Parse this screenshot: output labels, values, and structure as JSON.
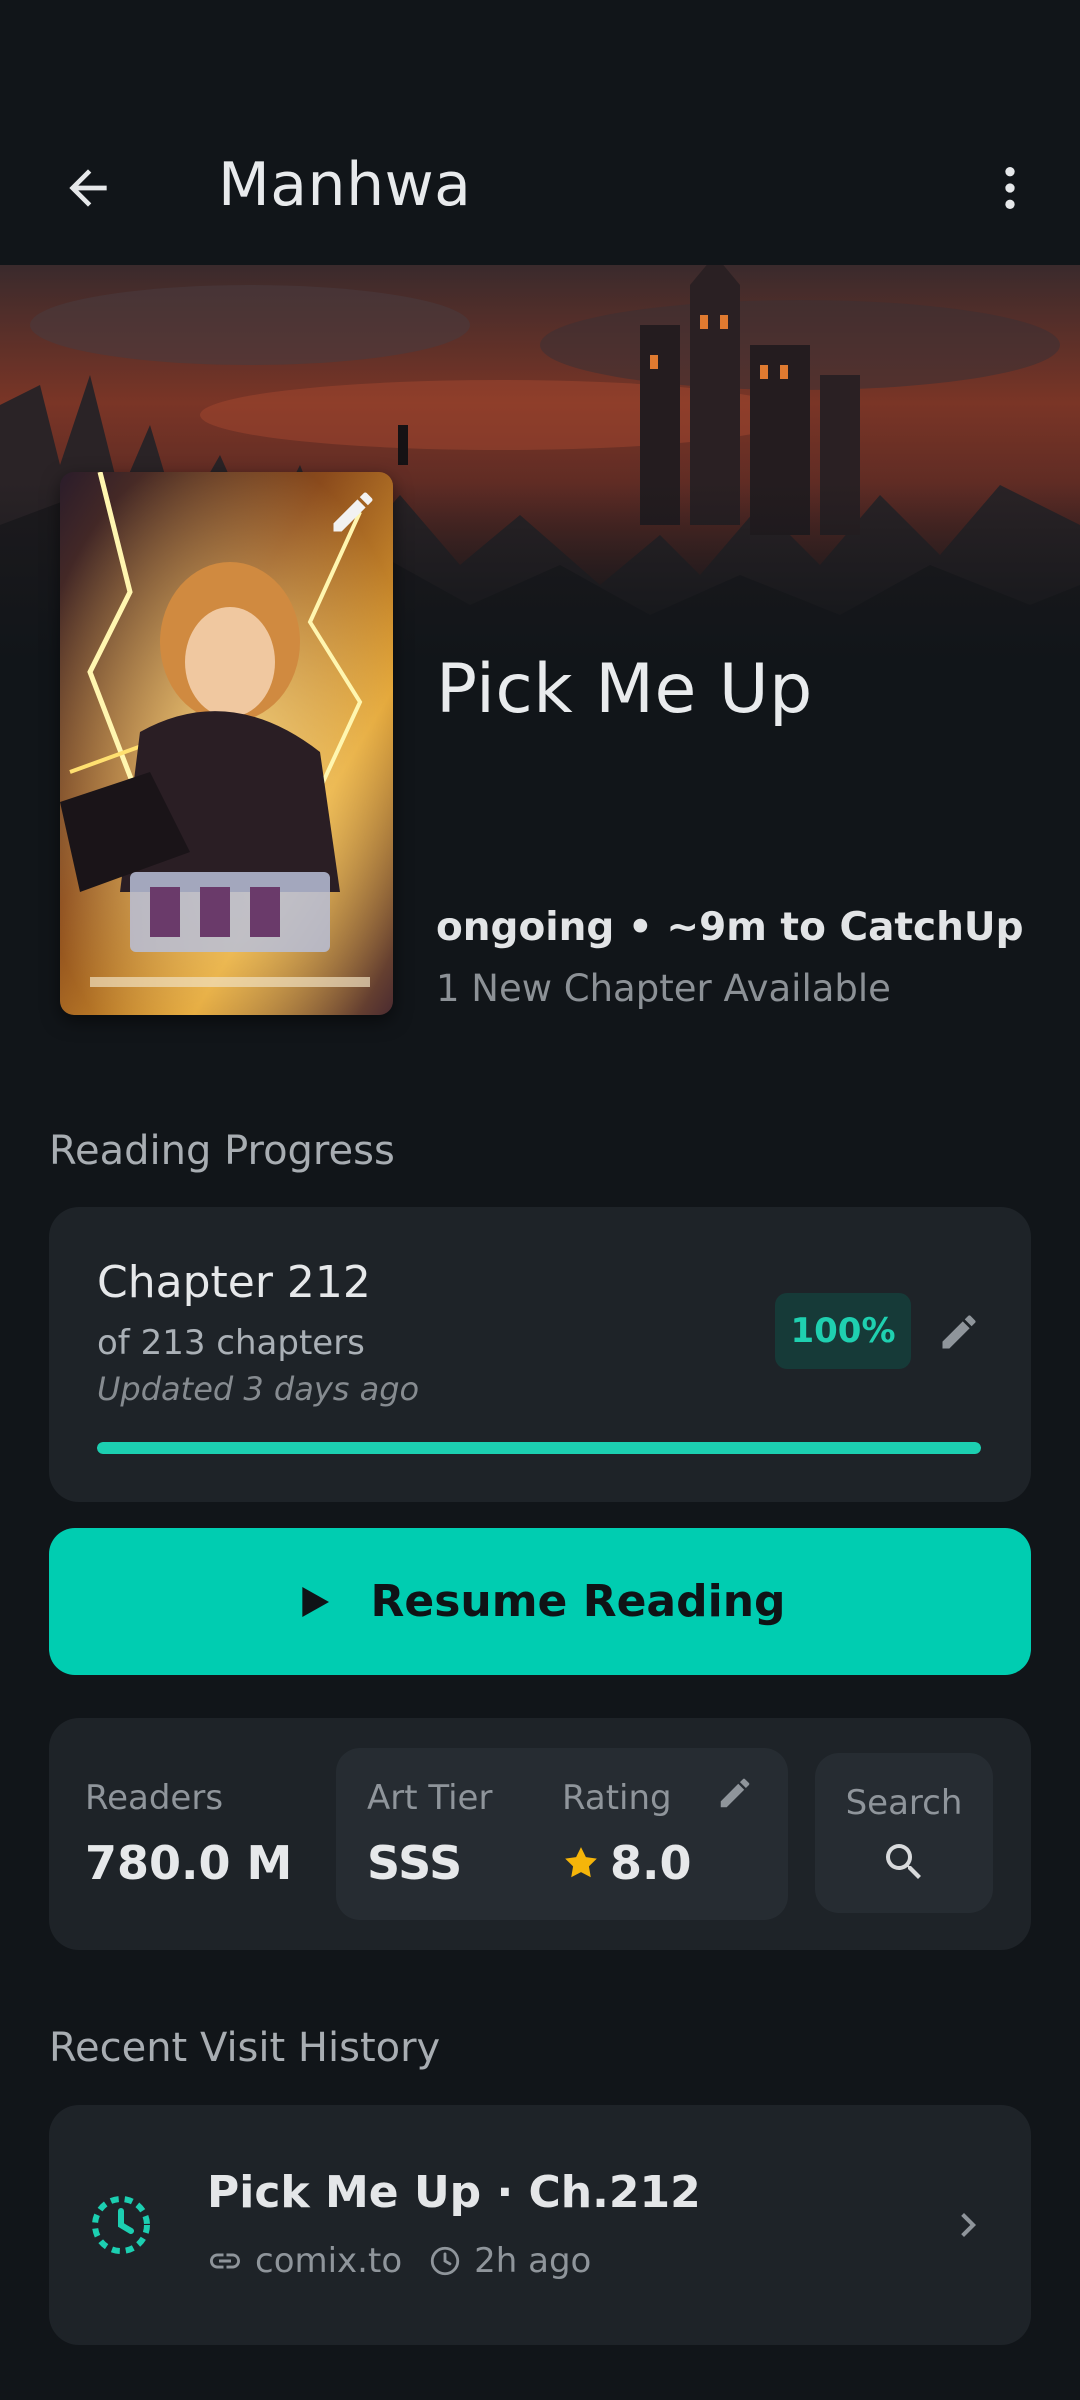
{
  "appbar": {
    "title": "Manhwa",
    "back_icon": "arrow-back-icon",
    "more_icon": "more-vert-icon"
  },
  "manga": {
    "title": "Pick Me Up",
    "status_line": "ongoing • ~9m to CatchUp",
    "new_chapters": "1 New Chapter Available",
    "cover_edit_icon": "pencil-icon"
  },
  "progress": {
    "section_label": "Reading Progress",
    "chapter": "Chapter 212",
    "of_chapters": "of 213 chapters",
    "updated": "Updated 3 days ago",
    "percent_label": "100%",
    "percent": 100
  },
  "resume": {
    "label": "Resume Reading",
    "icon": "play-icon"
  },
  "stats": {
    "readers_label": "Readers",
    "readers_value": "780.0 M",
    "art_tier_label": "Art Tier",
    "art_tier_value": "SSS",
    "rating_label": "Rating",
    "rating_value": "8.0",
    "search_label": "Search"
  },
  "history": {
    "section_label": "Recent Visit History",
    "items": [
      {
        "title": "Pick Me Up · Ch.212",
        "source": "comix.to",
        "time": "2h ago"
      }
    ]
  },
  "colors": {
    "accent": "#00cdb1",
    "background": "#111519",
    "card": "#1e2328",
    "star": "#f5b50a"
  }
}
